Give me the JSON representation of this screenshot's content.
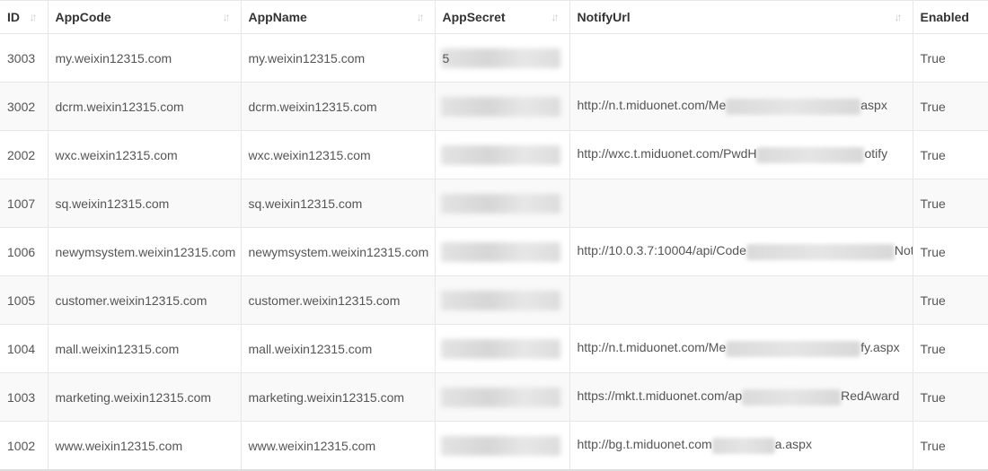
{
  "table": {
    "headers": [
      {
        "key": "id",
        "label": "ID"
      },
      {
        "key": "appcode",
        "label": "AppCode"
      },
      {
        "key": "appname",
        "label": "AppName"
      },
      {
        "key": "appsecret",
        "label": "AppSecret"
      },
      {
        "key": "notifyurl",
        "label": "NotifyUrl"
      },
      {
        "key": "enabled",
        "label": "Enabled"
      }
    ],
    "sort_icon": "sort-arrows-icon",
    "rows": [
      {
        "id": "3003",
        "appcode": "my.weixin12315.com",
        "appname": "my.weixin12315.com",
        "appsecret_visible": "5",
        "notify_head": "",
        "notify_tail": "",
        "enabled": "True"
      },
      {
        "id": "3002",
        "appcode": "dcrm.weixin12315.com",
        "appname": "dcrm.weixin12315.com",
        "appsecret_visible": "",
        "notify_head": "http://n.t.miduonet.com/Me",
        "notify_tail": "aspx",
        "enabled": "True"
      },
      {
        "id": "2002",
        "appcode": "wxc.weixin12315.com",
        "appname": "wxc.weixin12315.com",
        "appsecret_visible": "",
        "notify_head": "http://wxc.t.miduonet.com/PwdH",
        "notify_tail": "otify",
        "enabled": "True"
      },
      {
        "id": "1007",
        "appcode": "sq.weixin12315.com",
        "appname": "sq.weixin12315.com",
        "appsecret_visible": "",
        "notify_head": "",
        "notify_tail": "",
        "enabled": "True"
      },
      {
        "id": "1006",
        "appcode": "newymsystem.weixin12315.com",
        "appname": "newymsystem.weixin12315.com",
        "appsecret_visible": "",
        "notify_head": "http://10.0.3.7:10004/api/Code",
        "notify_tail": "Notify",
        "enabled": "True"
      },
      {
        "id": "1005",
        "appcode": "customer.weixin12315.com",
        "appname": "customer.weixin12315.com",
        "appsecret_visible": "",
        "notify_head": "",
        "notify_tail": "",
        "enabled": "True"
      },
      {
        "id": "1004",
        "appcode": "mall.weixin12315.com",
        "appname": "mall.weixin12315.com",
        "appsecret_visible": "",
        "notify_head": "http://n.t.miduonet.com/Me",
        "notify_tail": "fy.aspx",
        "enabled": "True"
      },
      {
        "id": "1003",
        "appcode": "marketing.weixin12315.com",
        "appname": "marketing.weixin12315.com",
        "appsecret_visible": "",
        "notify_head": "https://mkt.t.miduonet.com/ap",
        "notify_tail": "RedAward",
        "enabled": "True"
      },
      {
        "id": "1002",
        "appcode": "www.weixin12315.com",
        "appname": "www.weixin12315.com",
        "appsecret_visible": "",
        "notify_head": "http://bg.t.miduonet.com",
        "notify_tail": "a.aspx",
        "enabled": "True"
      }
    ]
  }
}
